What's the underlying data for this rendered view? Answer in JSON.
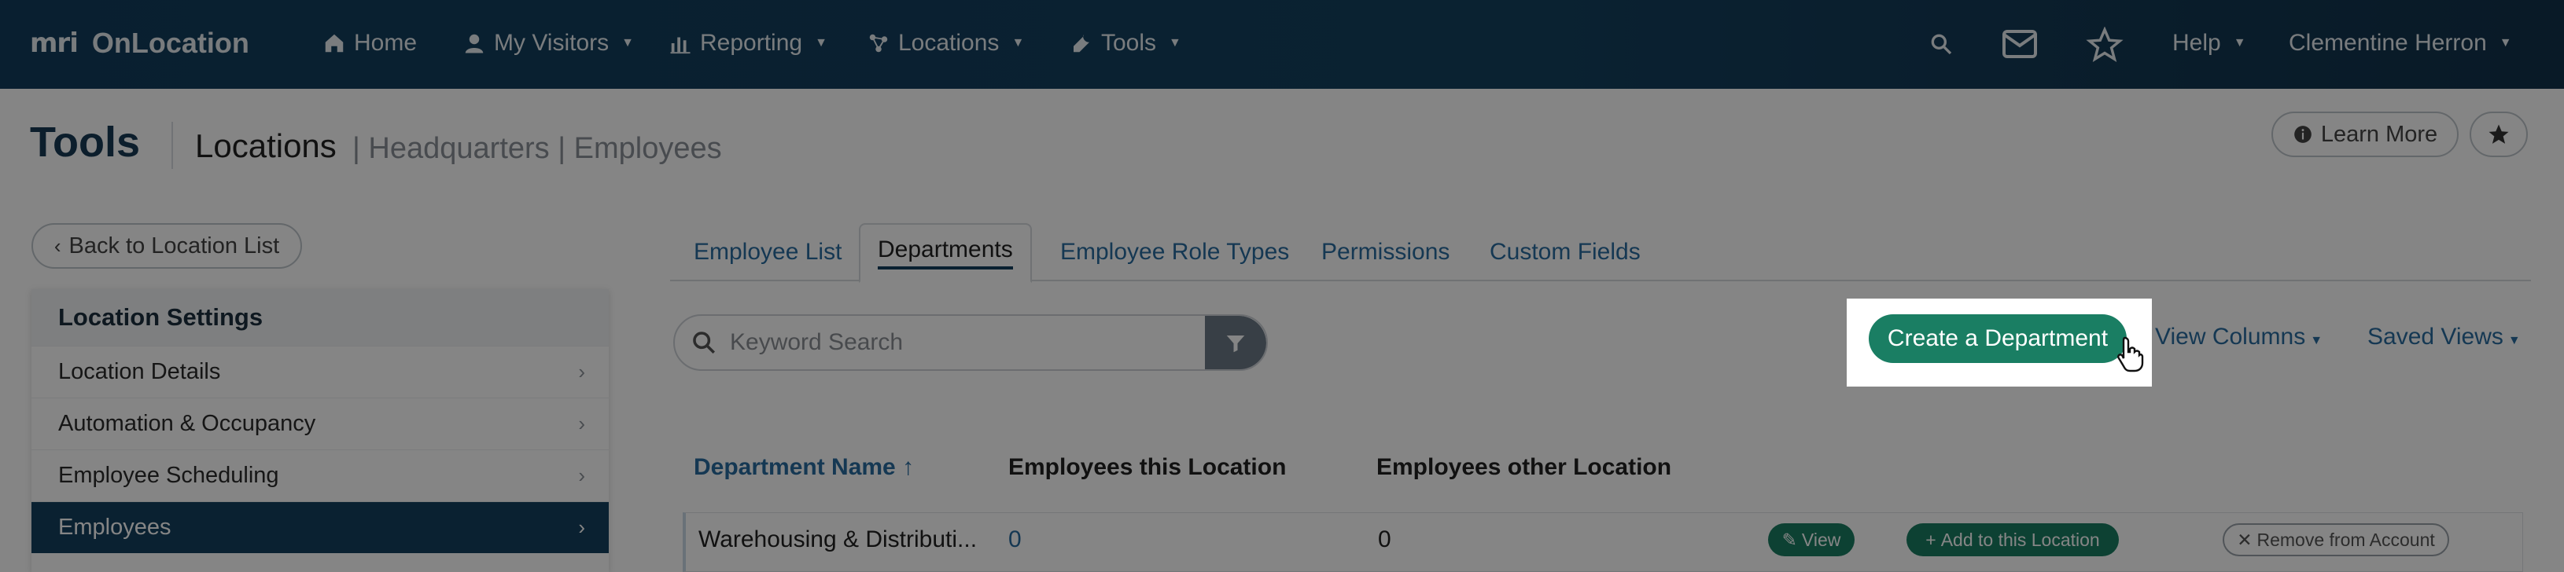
{
  "app": {
    "logo_mark": "mri",
    "name": "OnLocation"
  },
  "nav": {
    "home": "Home",
    "my_visitors": "My Visitors",
    "reporting": "Reporting",
    "locations": "Locations",
    "tools": "Tools",
    "help": "Help",
    "user": "Clementine Herron"
  },
  "page": {
    "title": "Tools",
    "crumb_main": "Locations",
    "crumb_rest": "| Headquarters | Employees",
    "learn_more": "Learn More"
  },
  "back_button": "Back to Location List",
  "settings": {
    "heading": "Location Settings",
    "items": [
      "Location Details",
      "Automation & Occupancy",
      "Employee Scheduling",
      "Employees"
    ]
  },
  "tabs": [
    "Employee List",
    "Departments",
    "Employee Role Types",
    "Permissions",
    "Custom Fields"
  ],
  "search": {
    "placeholder": "Keyword Search"
  },
  "actions": {
    "create": "Create a Department",
    "view_columns": "View Columns",
    "saved_views": "Saved Views"
  },
  "table": {
    "headers": [
      "Department Name ↑",
      "Employees this Location",
      "Employees other Location"
    ],
    "rows": [
      {
        "name": "Warehousing & Distributi...",
        "this_location": "0",
        "other_location": "0",
        "view": "View",
        "add": "Add to this Location",
        "remove": "Remove from Account"
      }
    ]
  },
  "colors": {
    "nav_bg": "#15415f",
    "primary_green": "#1a7e63",
    "link_blue": "#2a6ca0",
    "active_nav": "#15405f"
  }
}
